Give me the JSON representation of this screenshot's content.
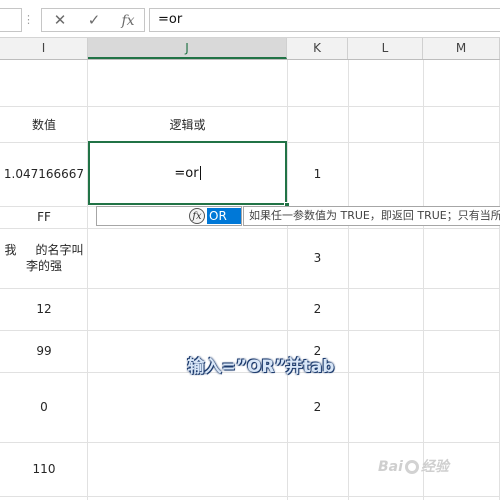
{
  "formula_bar": {
    "cancel_icon": "close-icon",
    "enter_icon": "check-icon",
    "fx_label": "fx",
    "formula_value": "=or"
  },
  "columns": [
    {
      "letter": "I",
      "active": false
    },
    {
      "letter": "J",
      "active": true
    },
    {
      "letter": "K",
      "active": false
    },
    {
      "letter": "L",
      "active": false
    },
    {
      "letter": "M",
      "active": false
    }
  ],
  "cells": {
    "header_i": "数值",
    "header_j": "逻辑或",
    "i_row2": "1.047166667",
    "j_row2_edit": "=or",
    "k_row2": "1",
    "i_row3": "FF",
    "i_row4_line1": "我     的名字叫",
    "i_row4_line2": "李的强",
    "k_row4": "3",
    "i_row5": "12",
    "k_row5": "2",
    "i_row6": "99",
    "k_row6": "2",
    "i_row7": "0",
    "k_row7": "2",
    "i_row8": "110"
  },
  "autocomplete": {
    "icon": "function-icon",
    "icon_glyph": "fx",
    "item": "OR",
    "tooltip": "如果任一参数值为 TRUE，即返回 TRUE；只有当所"
  },
  "overlay_caption": "输入=”OR”并tab",
  "watermark": {
    "left": "Bai",
    "right": "经验"
  },
  "colors": {
    "accent": "#217346",
    "selection": "#0078d7"
  }
}
